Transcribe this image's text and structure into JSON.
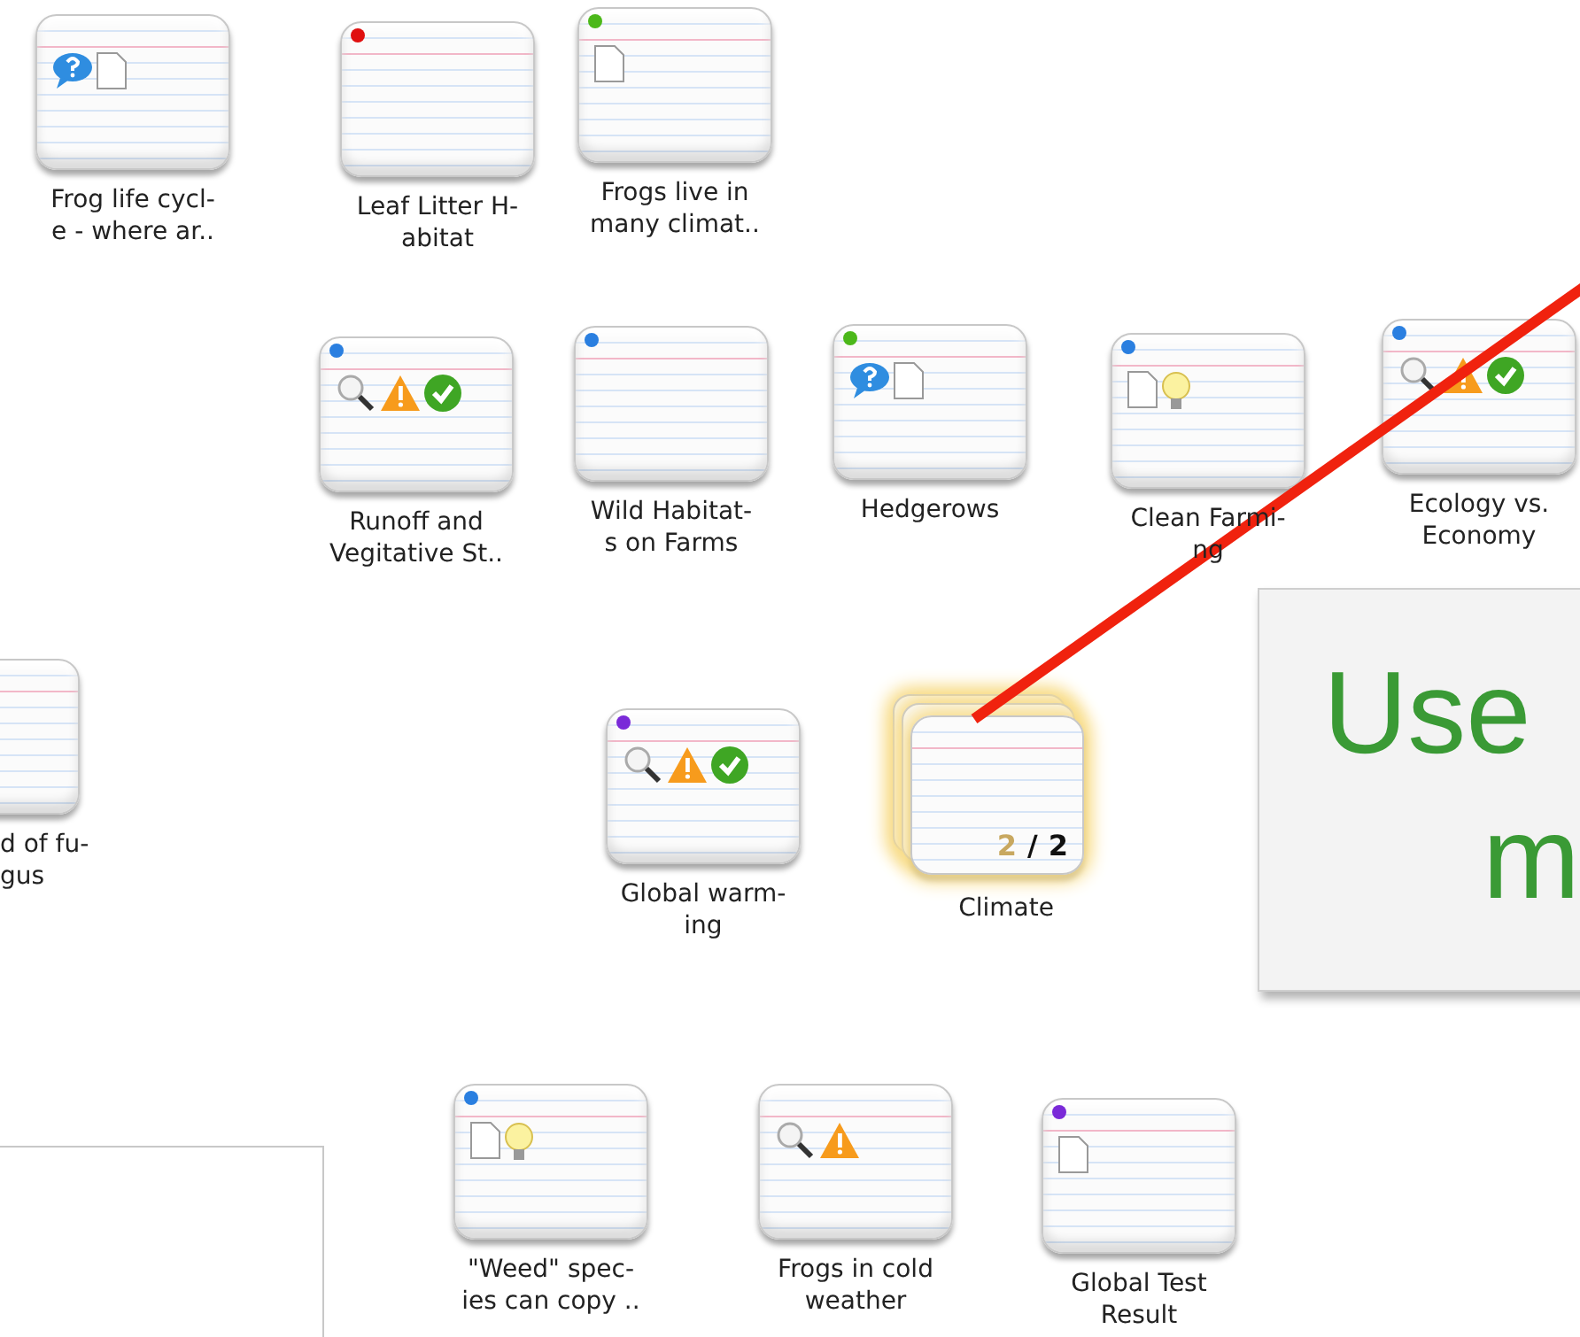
{
  "nodes": [
    {
      "kind": "card",
      "comment": true,
      "document": true,
      "label_lines": [
        "Frog life cycl-",
        "e - where ar.."
      ]
    },
    {
      "kind": "card",
      "color": "#e01010",
      "label_lines": [
        "Leaf Litter H-",
        "abitat"
      ]
    },
    {
      "kind": "card",
      "color": "#4cb81a",
      "document": true,
      "label_lines": [
        "Frogs live in",
        "many climat.."
      ]
    },
    {
      "kind": "card",
      "color": "#2a7fe0",
      "review": true,
      "warning": true,
      "approved": true,
      "label_lines": [
        "Runoff and",
        "Vegitative St.."
      ]
    },
    {
      "kind": "card",
      "color": "#2a7fe0",
      "label_lines": [
        "Wild Habitat-",
        "s on Farms"
      ]
    },
    {
      "kind": "card",
      "color": "#4cb81a",
      "comment": true,
      "document": true,
      "label_lines": [
        "Hedgerows"
      ]
    },
    {
      "kind": "card",
      "color": "#2a7fe0",
      "document": true,
      "idea": true,
      "label_lines": [
        "Clean Farmi-",
        "ng"
      ]
    },
    {
      "kind": "card",
      "color": "#2a7fe0",
      "review": true,
      "warning": true,
      "approved": true,
      "label_lines": [
        "Ecology vs.",
        "Economy"
      ]
    },
    {
      "kind": "card",
      "label_lines": [
        "d of fu-",
        "gus"
      ]
    },
    {
      "kind": "card",
      "color": "#7a2ad8",
      "review": true,
      "warning": true,
      "approved": true,
      "label_lines": [
        "Global warm-",
        "ing"
      ]
    },
    {
      "kind": "stack",
      "current": "2",
      "separator": "/",
      "total": "2",
      "label_lines": [
        "Climate"
      ]
    },
    {
      "kind": "card",
      "color": "#2a7fe0",
      "document": true,
      "idea": true,
      "label_lines": [
        "\"Weed\" spec-",
        "ies can copy .."
      ]
    },
    {
      "kind": "card",
      "review": true,
      "warning": true,
      "label_lines": [
        "Frogs in cold",
        "weather"
      ]
    },
    {
      "kind": "card",
      "color": "#7a2ad8",
      "document": true,
      "label_lines": [
        "Global Test",
        "Result"
      ]
    }
  ],
  "callout": {
    "lines": [
      "Use",
      "m"
    ]
  }
}
